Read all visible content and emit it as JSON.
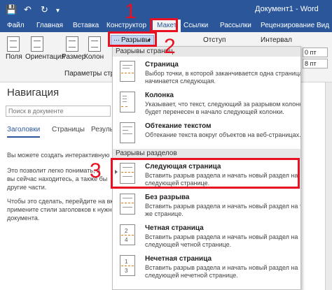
{
  "window": {
    "title": "Документ1 - Word",
    "qa_save_icon": "save-icon",
    "qa_undo_icon": "undo-icon",
    "qa_redo_icon": "redo-icon",
    "qa_menu_icon": "customize-quick-access-icon"
  },
  "tabs": [
    {
      "label": "Файл"
    },
    {
      "label": "Главная"
    },
    {
      "label": "Вставка"
    },
    {
      "label": "Конструктор"
    },
    {
      "label": "Макет"
    },
    {
      "label": "Ссылки"
    },
    {
      "label": "Рассылки"
    },
    {
      "label": "Рецензирование"
    },
    {
      "label": "Вид"
    }
  ],
  "ribbon": {
    "fields": "Поля",
    "orientation": "Ориентация",
    "size": "Размер",
    "columns": "Колон",
    "breaks": "Разрывы",
    "indent": "Отступ",
    "interval": "Интервал",
    "group_label": "Параметры стра",
    "before_value": "0 пт",
    "after_value": "8 пт"
  },
  "nav": {
    "title": "Навигация",
    "search_placeholder": "Поиск в документе",
    "tabs": [
      "Заголовки",
      "Страницы",
      "Резуль"
    ],
    "text": [
      "Вы можете создать интерактивную",
      "Это позволит легко понимать, в",
      "вы сейчас находитесь, а также бы",
      "другие части.",
      "Чтобы это сделать, перейдите на вкл",
      "примените стили заголовков к нужно",
      "документа."
    ]
  },
  "dropdown": {
    "page_breaks_header": "Разрывы страниц",
    "section_breaks_header": "Разрывы разделов",
    "items": [
      {
        "title": "Страница",
        "desc": [
          "Выбор точки, в которой заканчивается одна страница и",
          "начинается следующая."
        ],
        "icon": "page-break-icon"
      },
      {
        "title": "Колонка",
        "desc": [
          "Указывает, что текст, следующий за разрывом колонки,",
          "будет перенесен в начало следующей колонки."
        ],
        "icon": "column-break-icon"
      },
      {
        "title": "Обтекание текстом",
        "desc": [
          "Обтекание текста вокруг объектов на веб-страницах."
        ],
        "icon": "text-wrapping-break-icon"
      },
      {
        "title": "Следующая страница",
        "desc": [
          "Вставить разрыв раздела и начать новый раздел на",
          "следующей странице."
        ],
        "icon": "next-page-break-icon"
      },
      {
        "title": "Без разрыва",
        "desc": [
          "Вставить разрыв раздела и начать новый раздел на той",
          "же странице."
        ],
        "icon": "continuous-break-icon"
      },
      {
        "title": "Четная страница",
        "desc": [
          "Вставить разрыв раздела и начать новый раздел на",
          "следующей четной странице."
        ],
        "icon": "even-page-break-icon"
      },
      {
        "title": "Нечетная страница",
        "desc": [
          "Вставить разрыв раздела и начать новый раздел на",
          "следующей нечетной странице."
        ],
        "icon": "odd-page-break-icon"
      }
    ]
  },
  "annotations": {
    "one": "1",
    "two": "2",
    "three": "3",
    "color": "#e81123"
  },
  "colors": {
    "accent": "#2b579a",
    "ribbon": "#f3f3f3",
    "break_line": "#d57a1f"
  }
}
